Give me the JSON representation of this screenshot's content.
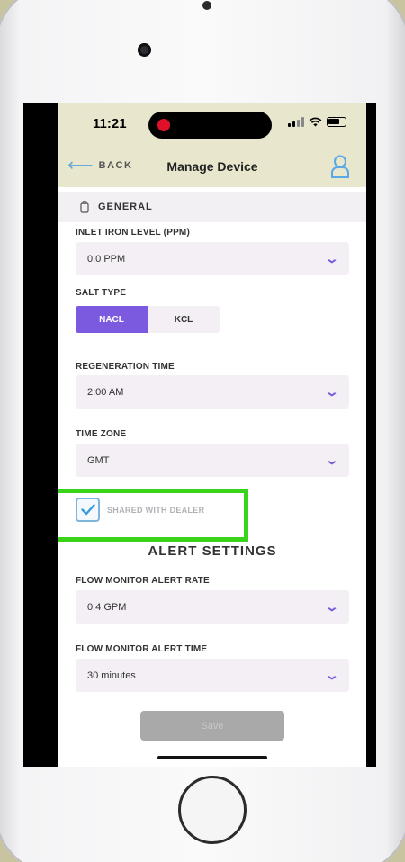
{
  "status_bar": {
    "time": "11:21"
  },
  "nav": {
    "back_label": "BACK",
    "title": "Manage Device"
  },
  "section": {
    "title": "GENERAL"
  },
  "fields": {
    "inlet_iron_level": {
      "label": "INLET IRON LEVEL (PPM)",
      "value": "0.0 PPM"
    },
    "salt_type": {
      "label": "SALT TYPE",
      "options": [
        "NACL",
        "KCL"
      ],
      "selected": "NACL"
    },
    "regeneration_time": {
      "label": "REGENERATION TIME",
      "value": "2:00 AM"
    },
    "time_zone": {
      "label": "TIME ZONE",
      "value": "GMT"
    },
    "shared_with_dealer": {
      "label": "SHARED WITH DEALER",
      "checked": true
    }
  },
  "alert_settings": {
    "title": "ALERT SETTINGS",
    "flow_monitor_alert_rate": {
      "label": "FLOW MONITOR ALERT RATE",
      "value": "0.4 GPM"
    },
    "flow_monitor_alert_time": {
      "label": "FLOW MONITOR ALERT TIME",
      "value": "30 minutes"
    }
  },
  "footer": {
    "save_label": "Save"
  },
  "colors": {
    "accent": "#7b5ae0",
    "header_bg": "#e8e6cc",
    "highlight": "#39d31a",
    "checkbox": "#7fb5dc"
  }
}
